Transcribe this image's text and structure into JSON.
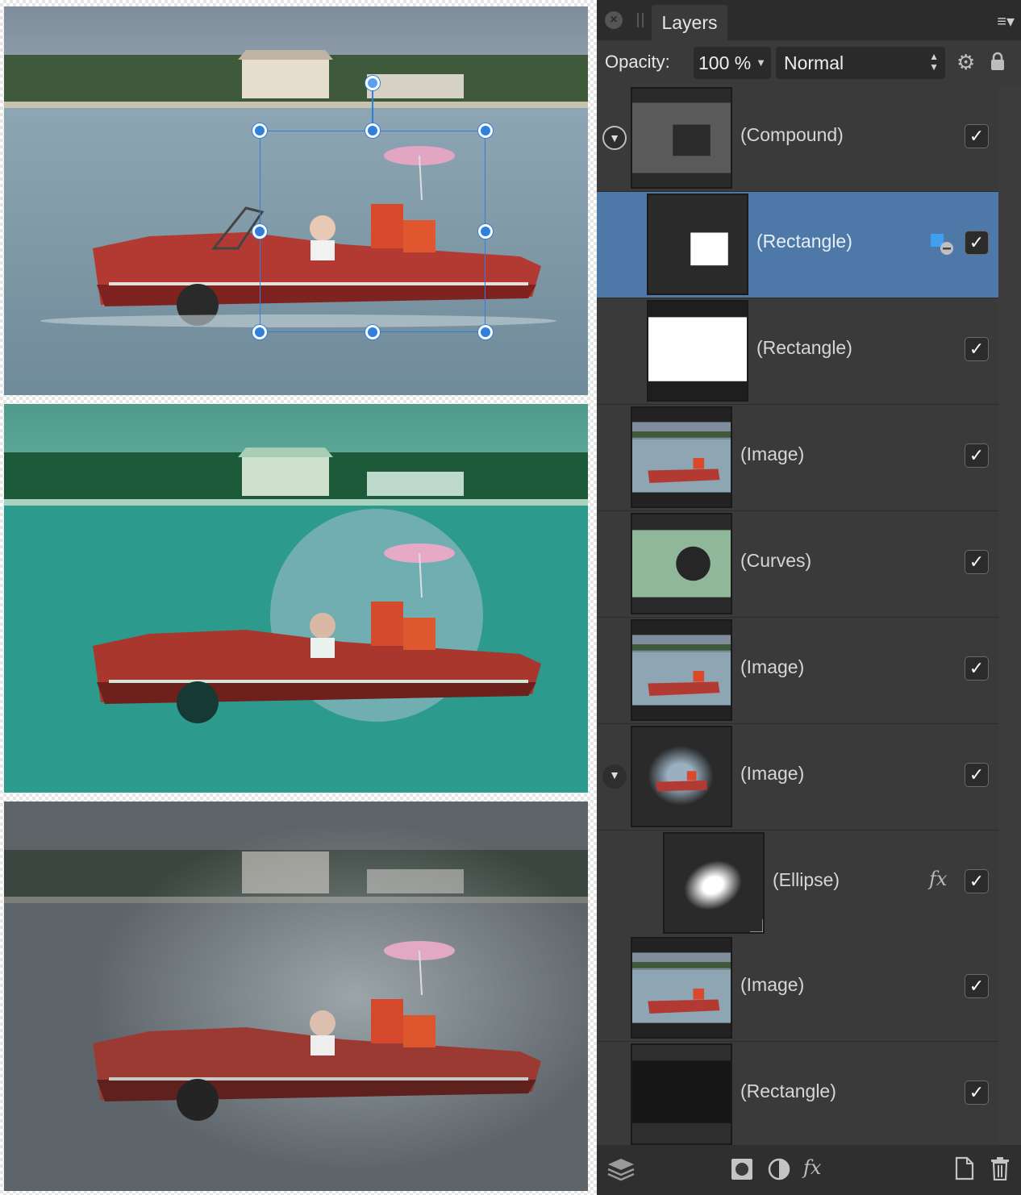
{
  "panel": {
    "tab_label": "Layers",
    "opacity_label": "Opacity:",
    "opacity_value": "100 %",
    "blend_mode": "Normal"
  },
  "layers": [
    {
      "label": "(Compound)",
      "visible": true
    },
    {
      "label": "(Rectangle)",
      "visible": true,
      "selected": true
    },
    {
      "label": "(Rectangle)",
      "visible": true
    },
    {
      "label": "(Image)",
      "visible": true
    },
    {
      "label": "(Curves)",
      "visible": true
    },
    {
      "label": "(Image)",
      "visible": true
    },
    {
      "label": "(Image)",
      "visible": true
    },
    {
      "label": "(Ellipse)",
      "visible": true
    },
    {
      "label": "(Image)",
      "visible": true
    },
    {
      "label": "(Rectangle)",
      "visible": true
    }
  ],
  "icons": {
    "close": "close-icon",
    "menu": "panel-menu-icon",
    "settings": "gear-icon",
    "lock": "lock-icon",
    "expand": "disclosure-triangle-icon",
    "fx": "fx-icon",
    "footer": [
      "layers-stack-icon",
      "mask-icon",
      "adjustment-icon",
      "fx-icon",
      "new-document-icon",
      "trash-icon"
    ]
  },
  "colors": {
    "selection_blue": "#2f7fdc",
    "selected_row": "#4d78a8",
    "panel_bg": "#3a3a3a"
  }
}
